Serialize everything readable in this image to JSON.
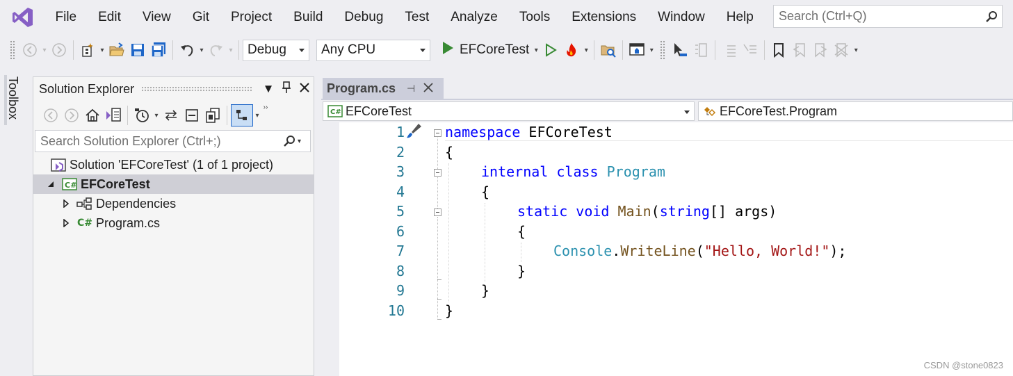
{
  "menu": {
    "items": [
      "File",
      "Edit",
      "View",
      "Git",
      "Project",
      "Build",
      "Debug",
      "Test",
      "Analyze",
      "Tools",
      "Extensions",
      "Window",
      "Help"
    ],
    "search_placeholder": "Search (Ctrl+Q)"
  },
  "toolbar": {
    "config": "Debug",
    "platform": "Any CPU",
    "run_target": "EFCoreTest"
  },
  "toolbox": {
    "label": "Toolbox"
  },
  "solution_explorer": {
    "title": "Solution Explorer",
    "search_placeholder": "Search Solution Explorer (Ctrl+;)",
    "solution_label": "Solution 'EFCoreTest' (1 of 1 project)",
    "project": "EFCoreTest",
    "items": [
      "Dependencies",
      "Program.cs"
    ]
  },
  "editor": {
    "tab_title": "Program.cs",
    "nav_project": "EFCoreTest",
    "nav_type": "EFCoreTest.Program",
    "line_numbers": [
      "1",
      "2",
      "3",
      "4",
      "5",
      "6",
      "7",
      "8",
      "9",
      "10"
    ],
    "code": {
      "l1_kw": "namespace",
      "l1_name": " EFCoreTest",
      "brace_open": "{",
      "brace_close": "}",
      "l3_kw": "internal class",
      "l3_type": "Program",
      "l5_kw1": "static void",
      "l5_method": "Main",
      "l5_paren": "(",
      "l5_kw2": "string",
      "l5_rest": "[] args)",
      "l7_type": "Console",
      "l7_dot": ".",
      "l7_method": "WriteLine",
      "l7_open": "(",
      "l7_str": "\"Hello, World!\"",
      "l7_close": ");"
    }
  },
  "watermark": "CSDN @stone0823"
}
